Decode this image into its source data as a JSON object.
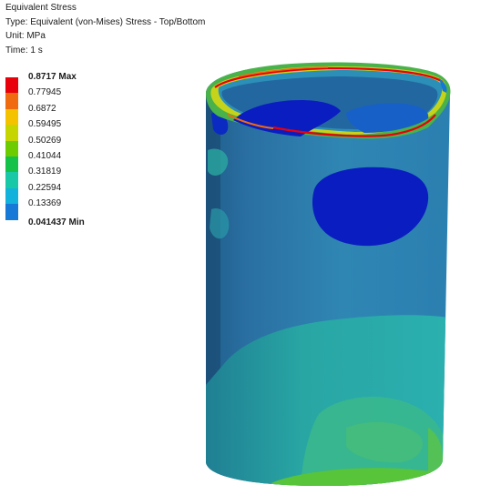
{
  "result_info": {
    "title": "Equivalent Stress",
    "type": "Type: Equivalent (von-Mises) Stress - Top/Bottom",
    "unit": "Unit: MPa",
    "time": "Time: 1 s"
  },
  "legend": {
    "labels": [
      "0.8717 Max",
      "0.77945",
      "0.6872",
      "0.59495",
      "0.50269",
      "0.41044",
      "0.31819",
      "0.22594",
      "0.13369",
      "0.041437 Min"
    ],
    "colors": [
      "#e8000b",
      "#f06a10",
      "#f5c200",
      "#c6d400",
      "#6ccc00",
      "#14c24a",
      "#18c8a6",
      "#12b2dc",
      "#1679d8",
      "#0a1dc0"
    ]
  },
  "model": {
    "name": "cylinder-stress-contour",
    "background_color": "#ffffff"
  }
}
